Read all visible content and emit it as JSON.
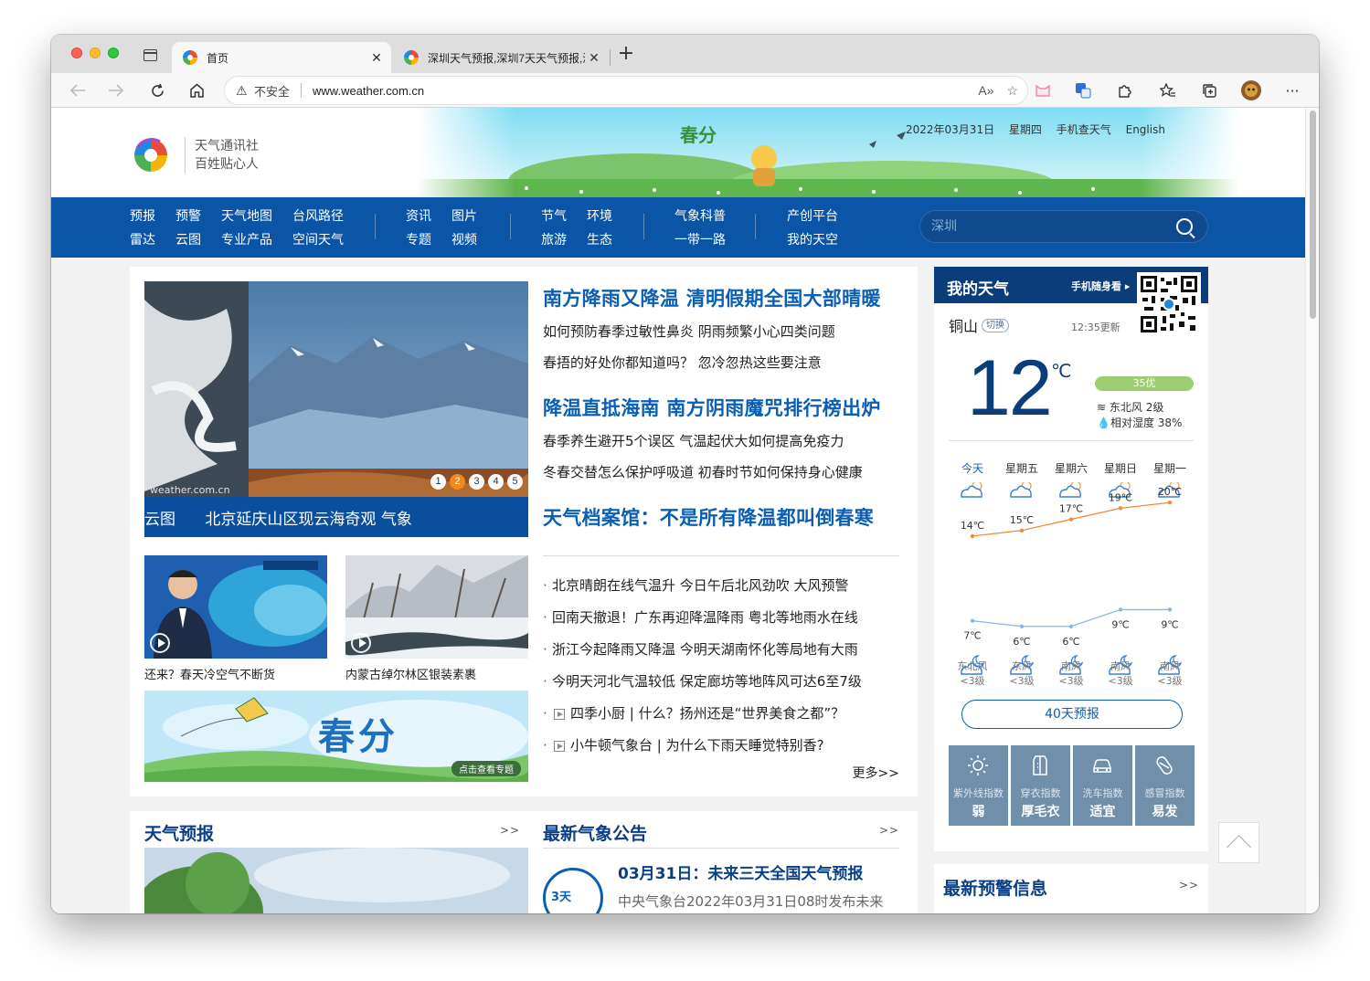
{
  "browser": {
    "tabs": [
      {
        "title": "首页",
        "close": "✕"
      },
      {
        "title": "深圳天气预报,深圳7天天气预报,深",
        "close": "✕"
      }
    ],
    "new_tab": "+",
    "url_warning_icon": "⚠",
    "url_insecure": "不安全",
    "url": "www.weather.com.cn"
  },
  "header": {
    "logo_line1": "天气通讯社",
    "logo_line2": "百姓贴心人",
    "banner_title": "春分",
    "date": "2022年03月31日",
    "weekday": "星期四",
    "mobile": "手机查天气",
    "english": "English"
  },
  "nav": {
    "group1": [
      "预报",
      "雷达",
      "预警",
      "云图",
      "天气地图",
      "专业产品",
      "台风路径",
      "空间天气"
    ],
    "group2": [
      "资讯",
      "专题",
      "图片",
      "视频"
    ],
    "group3": [
      "节气",
      "旅游",
      "环境",
      "生态"
    ],
    "group4": [
      "气象科普",
      "一带一路"
    ],
    "group5": [
      "产创平台",
      "我的天空"
    ],
    "search_placeholder": "深圳"
  },
  "slider": {
    "caption": "云图      北京延庆山区现云海奇观 气象",
    "watermark": "weather.com.cn",
    "dots": [
      "1",
      "2",
      "3",
      "4",
      "5"
    ],
    "active_dot": 2
  },
  "headlines": [
    {
      "title": "南方降雨又降温 清明假期全国大部晴暖",
      "subs": [
        "如何预防春季过敏性鼻炎 阴雨频繁小心四类问题",
        "春捂的好处你都知道吗？ 忽冷忽热这些要注意"
      ]
    },
    {
      "title": "降温直抵海南 南方阴雨魔咒排行榜出炉",
      "subs": [
        "春季养生避开5个误区 气温起伏大如何提高免疫力",
        "冬春交替怎么保护呼吸道 初春时节如何保持身心健康"
      ]
    },
    {
      "title": "天气档案馆：不是所有降温都叫倒春寒",
      "subs": []
    }
  ],
  "news": [
    {
      "text": "北京晴朗在线气温升 今日午后北风劲吹  大风预警",
      "video": false
    },
    {
      "text": "回南天撤退！广东再迎降温降雨 粤北等地雨水在线",
      "video": false
    },
    {
      "text": "浙江今起降雨又降温  今明天湖南怀化等局地有大雨",
      "video": false
    },
    {
      "text": "今明天河北气温较低 保定廊坊等地阵风可达6至7级",
      "video": false
    },
    {
      "text": "四季小厨 | 什么？扬州还是“世界美食之都”？",
      "video": true
    },
    {
      "text": "小牛顿气象台 | 为什么下雨天睡觉特别香?",
      "video": true
    }
  ],
  "more": "更多>>",
  "thumbs": [
    {
      "caption": "还来？春天冷空气不断货"
    },
    {
      "caption": "内蒙古绰尔林区银装素裹"
    }
  ],
  "promo": {
    "title": "春分",
    "button": "点击查看专题"
  },
  "lower": {
    "forecast_title": "天气预报",
    "forecast_more": ">>",
    "bulletin_section": "最新气象公告",
    "bulletin_more": ">>",
    "bulletin_icon": "3天",
    "bulletin_title": "03月31日：未来三天全国天气预报",
    "bulletin_text": "中央气象台2022年03月31日08时发布未来"
  },
  "my_weather": {
    "title": "我的天气",
    "mobile": "手机随身看 ▸",
    "city": "铜山",
    "switch": "切换",
    "updated": "12:35更新",
    "temp": "12",
    "unit": "℃",
    "aqi": "35优",
    "wind": "东北风 2级",
    "humidity": "相对湿度 38%",
    "days": [
      "今天",
      "星期五",
      "星期六",
      "星期日",
      "星期一"
    ],
    "highs": [
      14,
      15,
      17,
      19,
      20
    ],
    "lows": [
      7,
      6,
      6,
      9,
      9
    ],
    "high_labels": [
      "14℃",
      "15℃",
      "17℃",
      "19℃",
      "20℃"
    ],
    "low_labels": [
      "7℃",
      "6℃",
      "6℃",
      "9℃",
      "9℃"
    ],
    "winds": [
      [
        "东北风",
        "<3级"
      ],
      [
        "东风",
        "<3级"
      ],
      [
        "南风",
        "<3级"
      ],
      [
        "南风",
        "<3级"
      ],
      [
        "南风",
        "<3级"
      ]
    ],
    "btn40": "40天预报",
    "indices": [
      {
        "name": "紫外线指数",
        "value": "弱",
        "icon": "sun-icon"
      },
      {
        "name": "穿衣指数",
        "value": "厚毛衣",
        "icon": "coat-icon"
      },
      {
        "name": "洗车指数",
        "value": "适宜",
        "icon": "car-icon"
      },
      {
        "name": "感冒指数",
        "value": "易发",
        "icon": "pill-icon"
      }
    ]
  },
  "warning": {
    "title": "最新预警信息",
    "more": ">>"
  },
  "colors": {
    "nav": "#0a55a6",
    "headline": "#0a5fb4",
    "dark_blue": "#0b3d7a",
    "high_line": "#f08a3c",
    "low_line": "#8ab8e6"
  }
}
